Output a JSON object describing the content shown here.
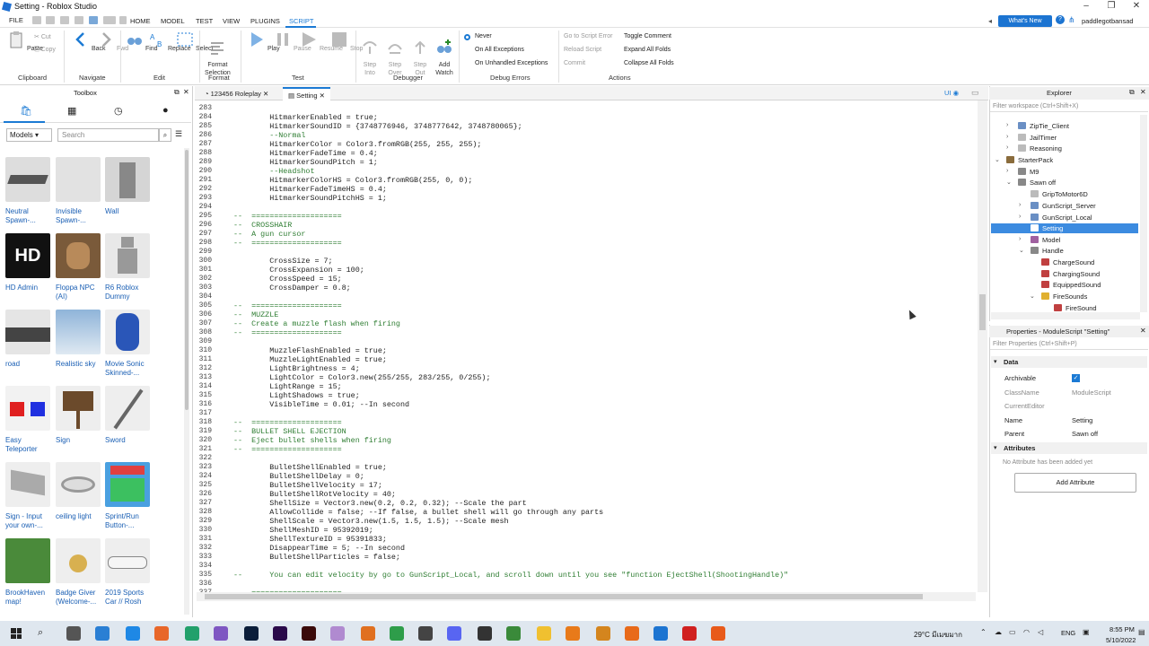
{
  "window": {
    "title": "Setting - Roblox Studio"
  },
  "menu": {
    "file": "FILE",
    "items": [
      "HOME",
      "MODEL",
      "TEST",
      "VIEW",
      "PLUGINS",
      "SCRIPT"
    ],
    "whats_new": "What's New",
    "username": "paddlegotbansad"
  },
  "ribbon": {
    "paste": "Paste",
    "cut": "Cut",
    "copy": "Copy",
    "clipboard": "Clipboard",
    "back": "Back",
    "fwd": "Fwd",
    "navigate": "Navigate",
    "find": "Find",
    "replace": "Replace",
    "select": "Select",
    "edit": "Edit",
    "format_selection": "Format\nSelection",
    "format": "Format",
    "play": "Play",
    "pause": "Pause",
    "resume": "Resume",
    "stop": "Stop",
    "test": "Test",
    "step_into": "Step\nInto",
    "step_over": "Step\nOver",
    "step_out": "Step\nOut",
    "add_watch": "Add\nWatch",
    "debugger": "Debugger",
    "never": "Never",
    "on_all_exceptions": "On All Exceptions",
    "on_unhandled": "On Unhandled Exceptions",
    "debug_errors": "Debug Errors",
    "go_to_error": "Go to Script Error",
    "reload_script": "Reload Script",
    "commit": "Commit",
    "toggle_comment": "Toggle Comment",
    "expand_all": "Expand All Folds",
    "collapse_all": "Collapse All Folds",
    "actions": "Actions"
  },
  "toolbox": {
    "title": "Toolbox",
    "category": "Models",
    "search_placeholder": "Search",
    "assets": [
      {
        "label": "Neutral\nSpawn-..."
      },
      {
        "label": "Invisible\nSpawn-..."
      },
      {
        "label": "Wall"
      },
      {
        "label": "HD Admin"
      },
      {
        "label": "Floppa NPC\n(AI)"
      },
      {
        "label": "R6 Roblox\nDummy"
      },
      {
        "label": "road"
      },
      {
        "label": "Realistic sky"
      },
      {
        "label": "Movie Sonic\nSkinned-..."
      },
      {
        "label": "Easy\nTeleporter"
      },
      {
        "label": "Sign"
      },
      {
        "label": "Sword"
      },
      {
        "label": "Sign - Input\nyour own-..."
      },
      {
        "label": "ceiling light"
      },
      {
        "label": "Sprint/Run\nButton-..."
      },
      {
        "label": "BrookHaven\nmap!"
      },
      {
        "label": "Badge Giver\n(Welcome-..."
      },
      {
        "label": "2019 Sports\nCar // Rosh"
      }
    ],
    "hd_text": "HD"
  },
  "editor": {
    "tabs": [
      "123456 Roleplay",
      "Setting"
    ],
    "ui_label": "UI",
    "lines": [
      {
        "n": "283",
        "t": ""
      },
      {
        "n": "284",
        "t": "        HitmarkerEnabled = true;"
      },
      {
        "n": "285",
        "t": "        HitmarkerSoundID = {3748776946, 3748777642, 3748780065};"
      },
      {
        "n": "286",
        "t": "        --Normal"
      },
      {
        "n": "287",
        "t": "        HitmarkerColor = Color3.fromRGB(255, 255, 255);"
      },
      {
        "n": "288",
        "t": "        HitmarkerFadeTime = 0.4;"
      },
      {
        "n": "289",
        "t": "        HitmarkerSoundPitch = 1;"
      },
      {
        "n": "290",
        "t": "        --Headshot"
      },
      {
        "n": "291",
        "t": "        HitmarkerColorHS = Color3.fromRGB(255, 0, 0);"
      },
      {
        "n": "292",
        "t": "        HitmarkerFadeTimeHS = 0.4;"
      },
      {
        "n": "293",
        "t": "        HitmarkerSoundPitchHS = 1;"
      },
      {
        "n": "294",
        "t": ""
      },
      {
        "n": "295",
        "t": "--  ===================="
      },
      {
        "n": "296",
        "t": "--  CROSSHAIR"
      },
      {
        "n": "297",
        "t": "--  A gun cursor"
      },
      {
        "n": "298",
        "t": "--  ===================="
      },
      {
        "n": "299",
        "t": ""
      },
      {
        "n": "300",
        "t": "        CrossSize = 7;"
      },
      {
        "n": "301",
        "t": "        CrossExpansion = 100;"
      },
      {
        "n": "302",
        "t": "        CrossSpeed = 15;"
      },
      {
        "n": "303",
        "t": "        CrossDamper = 0.8;"
      },
      {
        "n": "304",
        "t": ""
      },
      {
        "n": "305",
        "t": "--  ===================="
      },
      {
        "n": "306",
        "t": "--  MUZZLE"
      },
      {
        "n": "307",
        "t": "--  Create a muzzle flash when firing"
      },
      {
        "n": "308",
        "t": "--  ===================="
      },
      {
        "n": "309",
        "t": ""
      },
      {
        "n": "310",
        "t": "        MuzzleFlashEnabled = true;"
      },
      {
        "n": "311",
        "t": "        MuzzleLightEnabled = true;"
      },
      {
        "n": "312",
        "t": "        LightBrightness = 4;"
      },
      {
        "n": "313",
        "t": "        LightColor = Color3.new(255/255, 283/255, 0/255);"
      },
      {
        "n": "314",
        "t": "        LightRange = 15;"
      },
      {
        "n": "315",
        "t": "        LightShadows = true;"
      },
      {
        "n": "316",
        "t": "        VisibleTime = 0.01; --In second"
      },
      {
        "n": "317",
        "t": ""
      },
      {
        "n": "318",
        "t": "--  ===================="
      },
      {
        "n": "319",
        "t": "--  BULLET SHELL EJECTION"
      },
      {
        "n": "320",
        "t": "--  Eject bullet shells when firing"
      },
      {
        "n": "321",
        "t": "--  ===================="
      },
      {
        "n": "322",
        "t": ""
      },
      {
        "n": "323",
        "t": "        BulletShellEnabled = true;"
      },
      {
        "n": "324",
        "t": "        BulletShellDelay = 0;"
      },
      {
        "n": "325",
        "t": "        BulletShellVelocity = 17;"
      },
      {
        "n": "326",
        "t": "        BulletShellRotVelocity = 40;"
      },
      {
        "n": "327",
        "t": "        ShellSize = Vector3.new(0.2, 0.2, 0.32); --Scale the part"
      },
      {
        "n": "328",
        "t": "        AllowCollide = false; --If false, a bullet shell will go through any parts"
      },
      {
        "n": "329",
        "t": "        ShellScale = Vector3.new(1.5, 1.5, 1.5); --Scale mesh"
      },
      {
        "n": "330",
        "t": "        ShellMeshID = 95392019;"
      },
      {
        "n": "331",
        "t": "        ShellTextureID = 95391833;"
      },
      {
        "n": "332",
        "t": "        DisappearTime = 5; --In second"
      },
      {
        "n": "333",
        "t": "        BulletShellParticles = false;"
      },
      {
        "n": "334",
        "t": ""
      },
      {
        "n": "335",
        "t": "--      You can edit velocity by go to GunScript_Local, and scroll down until you see \"function EjectShell(ShootingHandle)\""
      },
      {
        "n": "336",
        "t": ""
      },
      {
        "n": "337",
        "t": "--  ===================="
      }
    ]
  },
  "explorer": {
    "title": "Explorer",
    "filter_placeholder": "Filter workspace (Ctrl+Shift+X)",
    "items": [
      {
        "label": "ZipTie_Client"
      },
      {
        "label": "JailTimer"
      },
      {
        "label": "Reasoning"
      },
      {
        "label": "StarterPack"
      },
      {
        "label": "M9"
      },
      {
        "label": "Sawn off"
      },
      {
        "label": "GripToMotor6D"
      },
      {
        "label": "GunScript_Server"
      },
      {
        "label": "GunScript_Local"
      },
      {
        "label": "Setting"
      },
      {
        "label": "Model"
      },
      {
        "label": "Handle"
      },
      {
        "label": "ChargeSound"
      },
      {
        "label": "ChargingSound"
      },
      {
        "label": "EquippedSound"
      },
      {
        "label": "FireSounds"
      },
      {
        "label": "FireSound"
      }
    ]
  },
  "properties": {
    "title": "Properties - ModuleScript \"Setting\"",
    "filter_placeholder": "Filter Properties (Ctrl+Shift+P)",
    "data_section": "Data",
    "archivable": "Archivable",
    "classname": "ClassName",
    "classname_val": "ModuleScript",
    "current_editor": "CurrentEditor",
    "name": "Name",
    "name_val": "Setting",
    "parent": "Parent",
    "parent_val": "Sawn off",
    "attributes_section": "Attributes",
    "no_attr": "No Attribute has been added yet",
    "add_attr": "Add Attribute"
  },
  "taskbar": {
    "weather": "29°C มีเมฆมาก",
    "lang": "ENG",
    "time": "8:55 PM",
    "date": "5/10/2022"
  }
}
